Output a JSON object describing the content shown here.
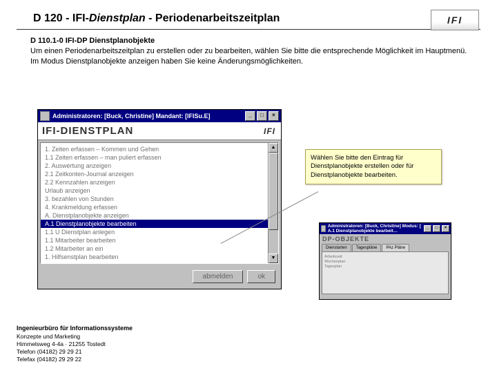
{
  "header": {
    "doc_id": "D 120 - IFI-",
    "title_italic": "Dienstplan",
    "title_rest": " - Periodenarbeitszeitplan",
    "logo_text": "IFI"
  },
  "section": {
    "heading": "D 110.1-0 IFI-DP Dienstplanobjekte",
    "body": "Um einen Periodenarbeitszeitplan zu erstellen oder zu bearbeiten, wählen Sie bitte die entsprechende Möglichkeit im Hauptmenü. Im Modus Dienstplanobjekte anzeigen haben Sie keine Änderungsmöglichkeiten."
  },
  "app_window": {
    "titlebar": "Administratoren: [Buck, Christine]   Mandant: [IFISu.E]",
    "banner": "IFI-DIENSTPLAN",
    "banner_logo": "IFI",
    "menu_items": [
      "1. Zeiten erfassen – Kommen und Gehen",
      "1.1  Zeiten erfassen – man puliert erfassen",
      "2. Auswertung anzeigen",
      "2.1  Zeitkonten-Journal anzeigen",
      "2.2  Kennzahlen anzeigen",
      "Urlaub anzeigen",
      "3.  bezahlen von Stunden",
      "4. Krankmeldung erfassen",
      "A. Dienstplanobjekte anzeigen",
      "A.1  Dienstplanobjekte bearbeiten",
      "1.1 U Dienstplan anlegen",
      "1.1 Mitarbeiter bearbeiten",
      "1.2 Mitarbeiter an ein",
      "1. Hilfsenstplan bearbeiten"
    ],
    "selected_index": 9,
    "buttons": {
      "logout": "abmelden",
      "ok": "ok"
    }
  },
  "callout": {
    "text": "Wählen Sie bitte den Eintrag für Dienstplanobjekte erstellen oder für Dienstplanobjekte bearbeiten."
  },
  "mini_window": {
    "titlebar": "Administratoren: [Buck, Christine]  Modus: [  A.1  Dienstplanobjekte bearbeit…",
    "banner": "DP-OBJEKTE",
    "tabs": [
      "Dienstarten",
      "Tagespläne",
      "PAz Pläne"
    ],
    "active_tab": 2,
    "rows": [
      "Arbeitszeit",
      "Wochenplan",
      "Tagesplan"
    ]
  },
  "footer": {
    "company": "Ingenieurbüro für Informationssysteme",
    "dept": "Konzepte und Marketing",
    "addr": "Himmelsweg 4-4a · 21255 Tostedt",
    "tel": "Telefon (04182) 29 29 21",
    "fax": "Telefax (04182) 29 29 22"
  }
}
